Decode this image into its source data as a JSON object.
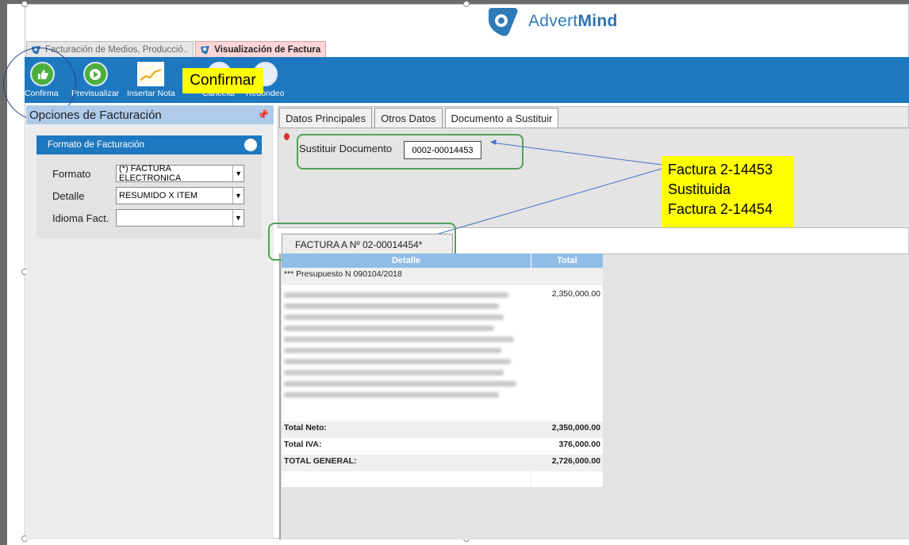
{
  "app": {
    "logo_text_plain": "Advert",
    "logo_text_bold": "Mind"
  },
  "tabs": [
    {
      "label": "Facturación de Medios, Producció..",
      "active": false
    },
    {
      "label": "Visualización de Factura",
      "active": true
    }
  ],
  "toolbar": {
    "buttons": [
      {
        "label": "Confirma",
        "icon": "thumbs-up-icon"
      },
      {
        "label": "Previsualizar",
        "icon": "play-icon"
      },
      {
        "label": "Insertar Nota",
        "icon": "chart-note-icon"
      },
      {
        "label": "Cancelar",
        "icon": "cancel-icon"
      },
      {
        "label": "Redondeo",
        "icon": "round-icon"
      }
    ]
  },
  "annotations": {
    "confirmar": "Confirmar",
    "factura_lines": [
      "Factura 2-14453",
      "Sustituida",
      "Factura 2-14454"
    ]
  },
  "left_panel": {
    "title": "Opciones de Facturación",
    "pin_icon": "pin-icon",
    "format_box": {
      "title": "Formato de Facturación",
      "fields": [
        {
          "label": "Formato",
          "value": "(*) FACTURA ELECTRONICA"
        },
        {
          "label": "Detalle",
          "value": "RESUMIDO X ITEM"
        },
        {
          "label": "Idioma Fact.",
          "value": ""
        }
      ]
    }
  },
  "sub_tabs": [
    {
      "label": "Datos Principales",
      "active": false
    },
    {
      "label": "Otros Datos",
      "active": false
    },
    {
      "label": "Documento a Sustituir",
      "active": true
    }
  ],
  "sustituir": {
    "label": "Sustituir Documento",
    "value": "0002-00014453"
  },
  "invoice": {
    "tab_label": "FACTURA A Nº 02-00014454*",
    "columns": [
      "Detalle",
      "Total"
    ],
    "rows": [
      {
        "detail": "*** Presupuesto N 090104/2018",
        "total": ""
      },
      {
        "detail": "",
        "total": "2,350,000.00"
      }
    ],
    "totals": [
      {
        "label": "Total Neto:",
        "value": "2,350,000.00"
      },
      {
        "label": "Total IVA:",
        "value": "376,000.00"
      },
      {
        "label": "TOTAL GENERAL:",
        "value": "2,726,000.00"
      }
    ]
  },
  "colors": {
    "toolbar_blue": "#1e78c0",
    "header_light_blue": "#aecbea",
    "callout_yellow": "#ffff00",
    "highlight_green": "#4ea25b"
  }
}
